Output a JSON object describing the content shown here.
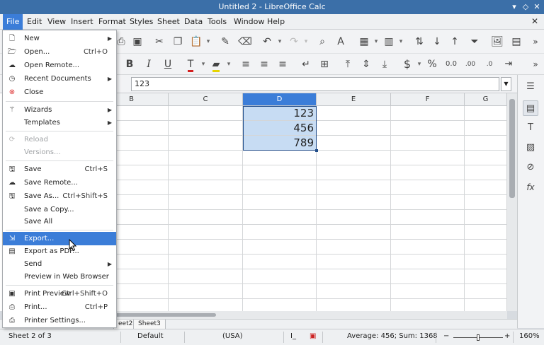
{
  "window": {
    "title": "Untitled 2 - LibreOffice Calc"
  },
  "menubar": [
    "File",
    "Edit",
    "View",
    "Insert",
    "Format",
    "Styles",
    "Sheet",
    "Data",
    "Tools",
    "Window",
    "Help"
  ],
  "formula": {
    "value": "123"
  },
  "columns": [
    "B",
    "C",
    "D",
    "E",
    "F",
    "G"
  ],
  "cells": {
    "D1": "123",
    "D2": "456",
    "D3": "789"
  },
  "file_menu": {
    "new": "New",
    "open": "Open...",
    "open_sc": "Ctrl+O",
    "open_remote": "Open Remote...",
    "recent": "Recent Documents",
    "close": "Close",
    "wizards": "Wizards",
    "templates": "Templates",
    "reload": "Reload",
    "versions": "Versions...",
    "save": "Save",
    "save_sc": "Ctrl+S",
    "save_remote": "Save Remote...",
    "save_as": "Save As...",
    "save_as_sc": "Ctrl+Shift+S",
    "save_copy": "Save a Copy...",
    "save_all": "Save All",
    "export": "Export...",
    "export_pdf": "Export as PDF...",
    "send": "Send",
    "preview_browser": "Preview in Web Browser",
    "print_preview": "Print Preview",
    "print_preview_sc": "Ctrl+Shift+O",
    "print": "Print...",
    "print_sc": "Ctrl+P",
    "printer_settings": "Printer Settings..."
  },
  "sheet_tabs": [
    "eet2",
    "Sheet3"
  ],
  "status": {
    "sheet": "Sheet 2 of 3",
    "style": "Default",
    "language": "(USA)",
    "selection": "Average: 456; Sum: 1368",
    "zoom_minus": "−",
    "zoom_plus": "+",
    "zoom": "160%"
  },
  "colors": {
    "accent": "#3b7dd8",
    "titlebar": "#3b6fa8",
    "selection_fill": "#c7dcf3"
  }
}
